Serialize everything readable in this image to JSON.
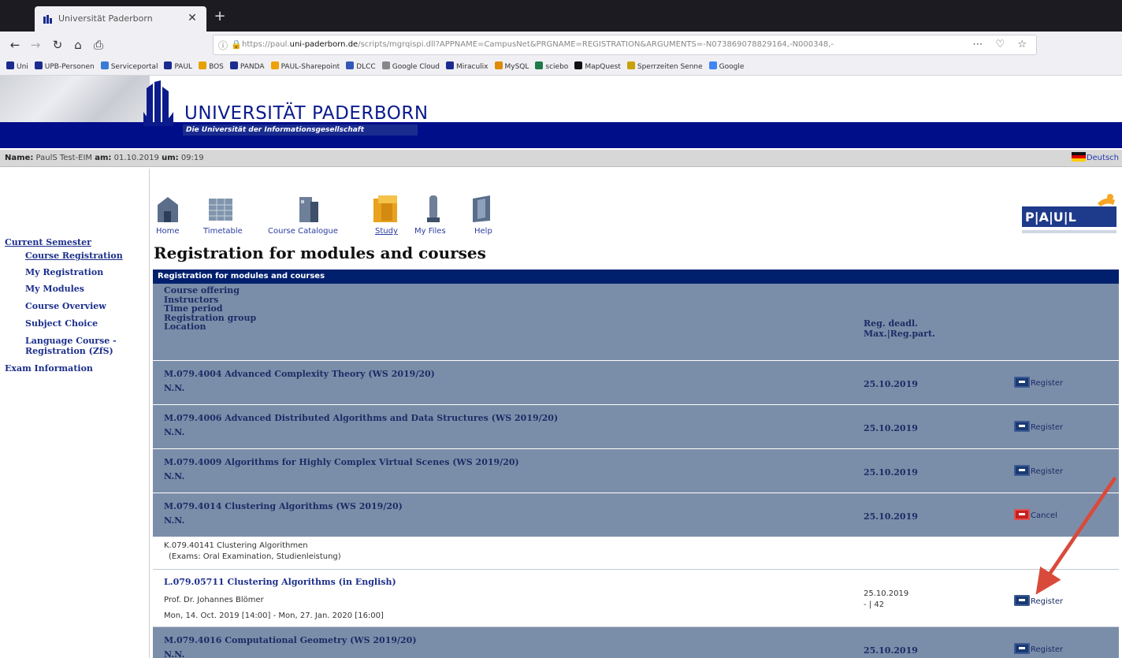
{
  "browser": {
    "tab_title": "Universität Paderborn",
    "url_prefix": "https://paul.",
    "url_domain": "uni-paderborn.de",
    "url_rest": "/scripts/mgrqispi.dll?APPNAME=CampusNet&PRGNAME=REGISTRATION&ARGUMENTS=-N073869078829164,-N000348,-",
    "bookmarks": [
      "Uni",
      "UPB-Personen",
      "Serviceportal",
      "PAUL",
      "BOS",
      "PANDA",
      "PAUL-Sharepoint",
      "DLCC",
      "Google Cloud",
      "Miraculix",
      "MySQL",
      "sciebo",
      "MapQuest",
      "Sperrzeiten Senne",
      "Google"
    ]
  },
  "header": {
    "logo_text": "UNIVERSITÄT PADERBORN",
    "logo_sub": "Die Universität der Informationsgesellschaft",
    "name_label": "Name:",
    "name_value": "PaulS Test-EIM",
    "date_label": "am:",
    "date_value": "01.10.2019",
    "time_label": "um:",
    "time_value": "09:19",
    "language": "Deutsch"
  },
  "sidebar": {
    "items": [
      {
        "label": "Current Semester"
      },
      {
        "label": "Course Registration"
      },
      {
        "label": "My Registration"
      },
      {
        "label": "My Modules"
      },
      {
        "label": "Course Overview"
      },
      {
        "label": "Subject Choice"
      },
      {
        "label": "Language Course -"
      },
      {
        "label": "Registration (ZfS)"
      },
      {
        "label": "Exam Information"
      }
    ]
  },
  "nav": {
    "items": [
      {
        "label": "Home"
      },
      {
        "label": "Timetable"
      },
      {
        "label": "Course Catalogue"
      },
      {
        "label": "Study"
      },
      {
        "label": "My Files"
      },
      {
        "label": "Help"
      }
    ]
  },
  "main": {
    "title": "Registration for modules and courses",
    "caption": "Registration for modules and courses",
    "header_left": [
      "Course offering",
      "Instructors",
      "Time period",
      "Registration group",
      "Location"
    ],
    "header_right": [
      "Reg. deadl.",
      "Max.|Reg.part."
    ],
    "rows": [
      {
        "title": "M.079.4004 Advanced Complexity Theory (WS 2019/20)",
        "sub": "N.N.",
        "deadline": "25.10.2019",
        "action": "Register"
      },
      {
        "title": "M.079.4006 Advanced Distributed Algorithms and Data Structures (WS 2019/20)",
        "sub": "N.N.",
        "deadline": "25.10.2019",
        "action": "Register"
      },
      {
        "title": "M.079.4009 Algorithms for Highly Complex Virtual Scenes (WS 2019/20)",
        "sub": "N.N.",
        "deadline": "25.10.2019",
        "action": "Register"
      },
      {
        "title": "M.079.4014 Clustering Algorithms (WS 2019/20)",
        "sub": "N.N.",
        "deadline": "25.10.2019",
        "action": "Cancel"
      }
    ],
    "exam_row": {
      "line1": "K.079.40141 Clustering Algorithmen",
      "line2": "(Exams: Oral Examination, Studienleistung)"
    },
    "course_row": {
      "title": "L.079.05711 Clustering Algorithms (in English)",
      "instructor": "Prof. Dr. Johannes Blömer",
      "period": "Mon, 14. Oct. 2019 [14:00] - Mon, 27. Jan. 2020 [16:00]",
      "deadline": "25.10.2019",
      "participants": "- | 42",
      "action": "Register"
    },
    "last_row": {
      "title": "M.079.4016 Computational Geometry (WS 2019/20)",
      "sub": "N.N.",
      "deadline": "25.10.2019",
      "action": "Register"
    }
  },
  "paul_logo": "P|A|U|L",
  "colors": {
    "brand_blue": "#000e8a",
    "table_header": "#00206e",
    "row_bg": "#7b8ea9",
    "annotation_arrow": "#d94a3a"
  }
}
